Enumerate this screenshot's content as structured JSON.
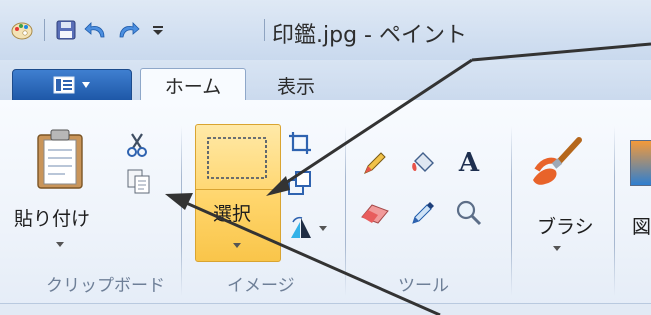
{
  "window": {
    "title": "印鑑.jpg - ペイント"
  },
  "qat": {
    "app_icon": "paint-palette-icon",
    "save_icon": "floppy-disk-icon",
    "undo_icon": "undo-arrow-icon",
    "redo_icon": "redo-arrow-icon",
    "customize_icon": "qat-customize-icon"
  },
  "tabs": {
    "home": "ホーム",
    "view": "表示"
  },
  "groups": {
    "clipboard": {
      "label": "クリップボード",
      "paste_label": "貼り付け"
    },
    "image": {
      "label": "イメージ",
      "select_label": "選択"
    },
    "tools": {
      "label": "ツール",
      "text_tool_glyph": "A"
    },
    "brushes": {
      "label": "ブラシ"
    }
  },
  "partial": {
    "next_group_glyph": "図"
  },
  "colors": {
    "accent_blue": "#1e58a8",
    "selected_orange": "#ffd56b",
    "annotation_arrow": "#333333"
  }
}
